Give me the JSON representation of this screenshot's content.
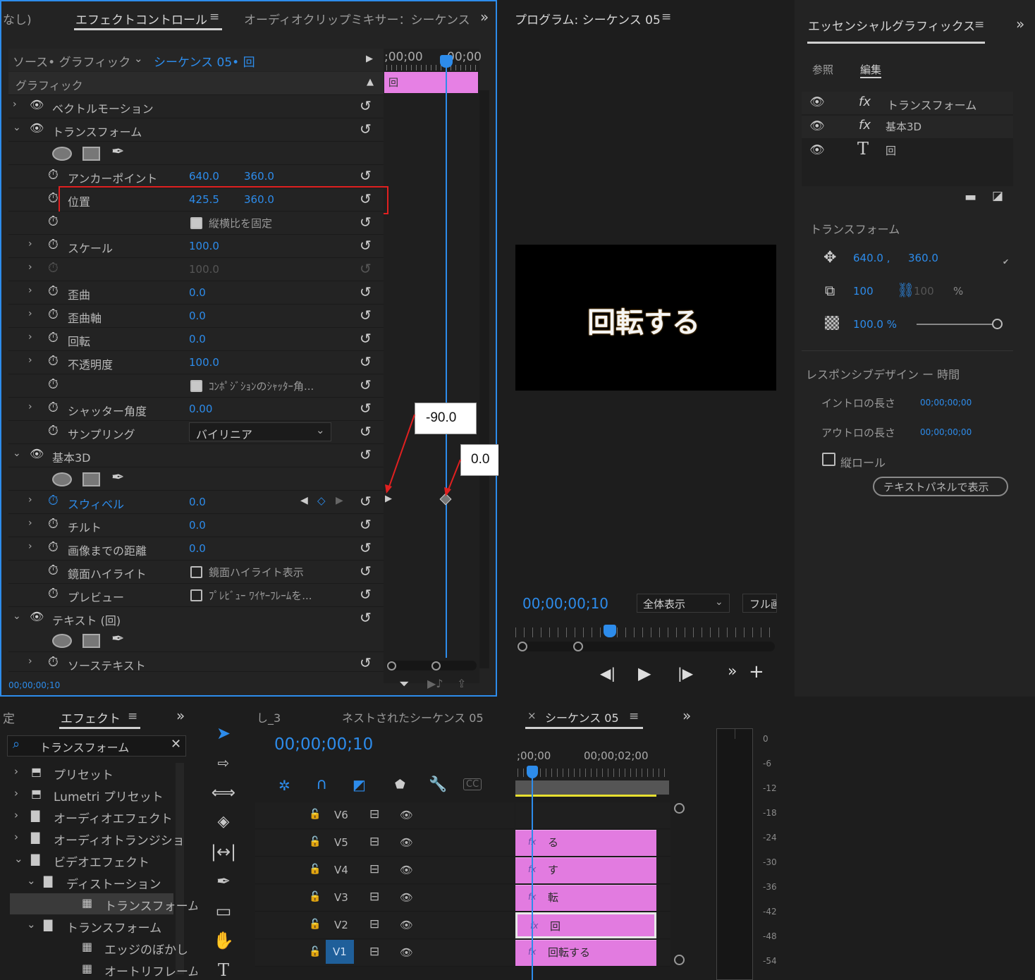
{
  "effect_controls": {
    "tabs": [
      "なし)",
      "エフェクトコントロール",
      "オーディオクリップミキサー：シーケンス"
    ],
    "source_label": "ソース• グラフィック",
    "sequence_label": "シーケンス 05• 回",
    "time_start": ";00;00",
    "time_end": "00;00",
    "clip_label": "回",
    "section_graphic": "グラフィック",
    "rows": {
      "vector_motion": "ベクトルモーション",
      "transform": "トランスフォーム",
      "anchor_label": "アンカーポイント",
      "anchor_x": "640.0",
      "anchor_y": "360.0",
      "position_label": "位置",
      "position_x": "425.5",
      "position_y": "360.0",
      "uniform_scale": "縦横比を固定",
      "scale_label": "スケール",
      "scale_value": "100.0",
      "scale_width": "100.0",
      "skew_label": "歪曲",
      "skew_value": "0.0",
      "skew_axis_label": "歪曲軸",
      "skew_axis_value": "0.0",
      "rotation_label": "回転",
      "rotation_value": "0.0",
      "opacity_label": "不透明度",
      "opacity_value": "100.0",
      "shutter_comp": "ｺﾝﾎﾟｼﾞｼｮﾝのｼｬｯﾀｰ角...",
      "shutter_angle_label": "シャッター角度",
      "shutter_angle_value": "0.00",
      "sampling_label": "サンプリング",
      "sampling_value": "バイリニア",
      "basic3d": "基本3D",
      "swivel_label": "スウィベル",
      "swivel_value": "0.0",
      "tilt_label": "チルト",
      "tilt_value": "0.0",
      "distance_label": "画像までの距離",
      "distance_value": "0.0",
      "specular_label": "鏡面ハイライト",
      "specular_check": "鏡面ハイライト表示",
      "preview_label": "プレビュー",
      "preview_check": "ﾌﾟﾚﾋﾞｭｰ ﾜｲﾔｰﾌﾚｰﾑを...",
      "text_layer": "テキスト (回)",
      "source_text": "ソーステキスト"
    },
    "timecode": "00;00;00;10"
  },
  "callouts": {
    "first": "-90.0",
    "second": "0.0"
  },
  "program": {
    "title": "プログラム: シーケンス 05",
    "video_text": "回転する",
    "timecode": "00;00;00;10",
    "fit": "全体表示",
    "quality": "フル画"
  },
  "essential_graphics": {
    "title": "エッセンシャルグラフィックス",
    "tab_browse": "参照",
    "tab_edit": "編集",
    "layers": [
      {
        "icon": "fx",
        "name": "トランスフォーム"
      },
      {
        "icon": "fx",
        "name": "基本3D"
      },
      {
        "icon": "T",
        "name": "回"
      }
    ],
    "transform_title": "トランスフォーム",
    "pos_x": "640.0 ,",
    "pos_y": "360.0",
    "scale": "100",
    "scale2": "100",
    "percent": "%",
    "opacity": "100.0 %",
    "responsive_title": "レスポンシブデザイン ー 時間",
    "intro_label": "イントロの長さ",
    "intro_value": "00;00;00;00",
    "outro_label": "アウトロの長さ",
    "outro_value": "00;00;00;00",
    "roll_label": "縦ロール",
    "text_panel_button": "テキストパネルで表示"
  },
  "effects_panel": {
    "tab_prev": "定",
    "title": "エフェクト",
    "search_value": "トランスフォーム",
    "items": [
      {
        "label": "プリセット",
        "indent": 0,
        "kind": "preset"
      },
      {
        "label": "Lumetri プリセット",
        "indent": 0,
        "kind": "preset"
      },
      {
        "label": "オーディオエフェクト",
        "indent": 0,
        "kind": "folder"
      },
      {
        "label": "オーディオトランジショ",
        "indent": 0,
        "kind": "folder"
      },
      {
        "label": "ビデオエフェクト",
        "indent": 0,
        "kind": "folder",
        "open": true
      },
      {
        "label": "ディストーション",
        "indent": 1,
        "kind": "folder",
        "open": true
      },
      {
        "label": "トランスフォーム",
        "indent": 2,
        "kind": "effect",
        "selected": true
      },
      {
        "label": "トランスフォーム",
        "indent": 1,
        "kind": "folder",
        "open": true
      },
      {
        "label": "エッジのぼかし",
        "indent": 2,
        "kind": "effect"
      },
      {
        "label": "オートリフレーム",
        "indent": 2,
        "kind": "effect"
      }
    ]
  },
  "timeline": {
    "tabs": [
      "し_3",
      "ネストされたシーケンス 05",
      "シーケンス 05"
    ],
    "close": "×",
    "timecode": "00;00;00;10",
    "ruler_start": ";00;00",
    "ruler_mark": "00;00;02;00",
    "tracks": [
      {
        "name": "V6",
        "clip": ""
      },
      {
        "name": "V5",
        "clip": "る"
      },
      {
        "name": "V4",
        "clip": "す"
      },
      {
        "name": "V3",
        "clip": "転"
      },
      {
        "name": "V2",
        "clip": "回"
      },
      {
        "name": "V1",
        "clip": "回転する"
      }
    ],
    "fx_label": "fx"
  },
  "meter": {
    "labels": [
      "0",
      "-6",
      "-12",
      "-18",
      "-24",
      "-30",
      "-36",
      "-42",
      "-48",
      "-54"
    ]
  }
}
